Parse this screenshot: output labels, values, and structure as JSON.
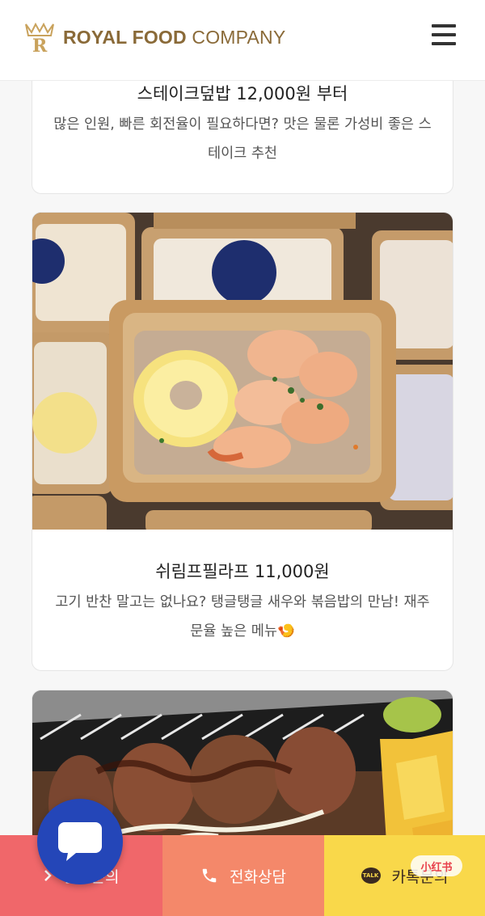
{
  "header": {
    "logo_bold": "ROYAL FOOD",
    "logo_light": "COMPANY",
    "menu_icon": "hamburger-icon",
    "brand_color": "#8a6a38"
  },
  "cards": [
    {
      "title": "스테이크덮밥 12,000원 부터",
      "desc": "많은 인원, 빠른 회전율이 필요하다면? 맛은 물론 가성비 좋은 스테이크 추천"
    },
    {
      "title": "쉬림프필라프 11,000원",
      "desc": "고기 반찬 말고는 없나요? 탱글탱글 새우와 볶음밥의 만남! 재주문율 높은 메뉴🍤"
    },
    {
      "title": "",
      "desc": ""
    }
  ],
  "bottom_bar": {
    "estimate_label": "견적문의",
    "phone_label": "전화상담",
    "kakao_label": "카톡문의",
    "estimate_color": "#f0676a",
    "phone_color": "#f4886a",
    "kakao_color": "#f9d84a"
  },
  "chat_fab": {
    "icon": "chat-bubble-icon",
    "color": "#2446b8"
  },
  "watermark": {
    "text": "小红书"
  }
}
